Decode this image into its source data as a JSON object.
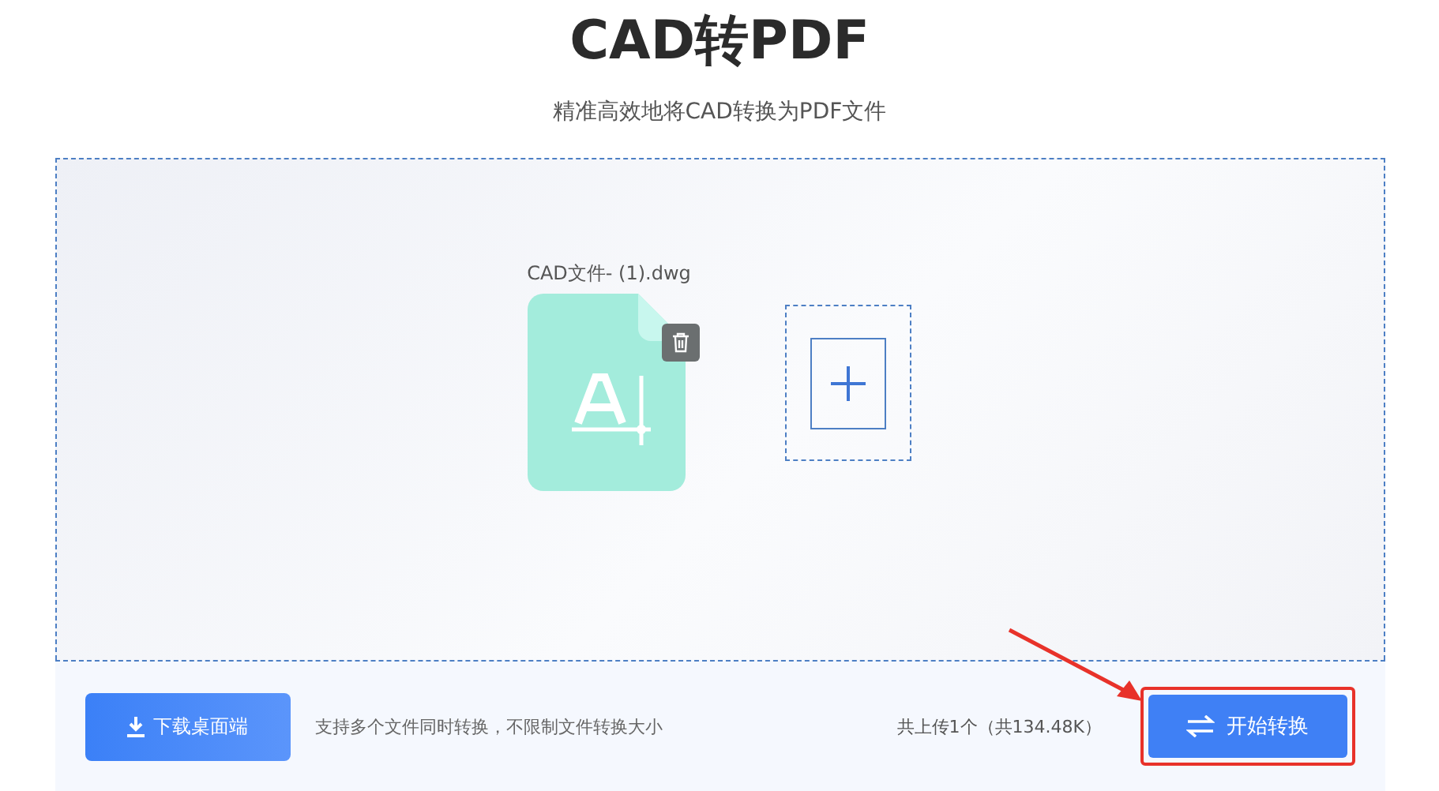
{
  "title": "CAD转PDF",
  "subtitle": "精准高效地将CAD转换为PDF文件",
  "files": [
    {
      "name": "CAD文件- (1).dwg"
    }
  ],
  "download_button": "下载桌面端",
  "hint": "支持多个文件同时转换，不限制文件转换大小",
  "summary": "共上传1个（共134.48K）",
  "convert_button": "开始转换"
}
